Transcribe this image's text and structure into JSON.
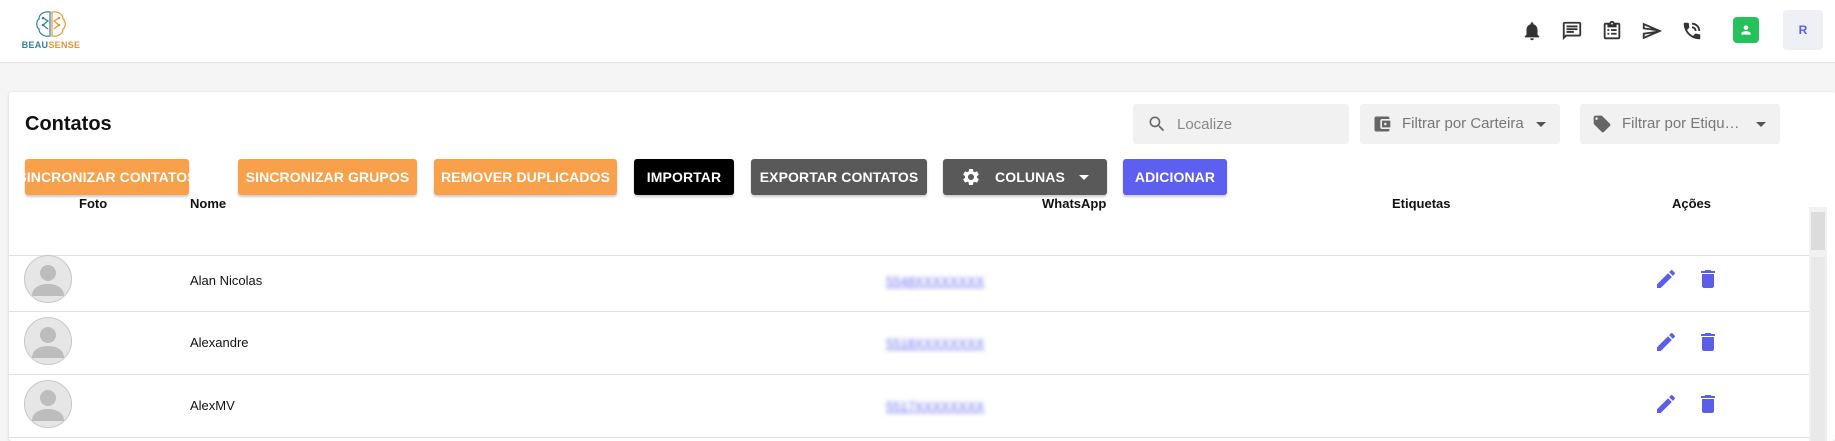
{
  "app": {
    "logo_text_1": "BEAU",
    "logo_text_2": "SENSE"
  },
  "topbar": {
    "icons": [
      "bell-icon",
      "chat-icon",
      "clipboard-icon",
      "send-icon",
      "phone-icon",
      "user-status-icon"
    ],
    "avatar_initial": "R",
    "status_color": "#25c15a",
    "accent_color": "#5b5fe8"
  },
  "page": {
    "title": "Contatos",
    "search_placeholder": "Localize",
    "filter_wallet": "Filtrar por Carteira",
    "filter_tags": "Filtrar por Etiquetas"
  },
  "toolbar": {
    "sync_contacts": "SINCRONIZAR CONTATOS",
    "sync_groups": "SINCRONIZAR GRUPOS",
    "remove_duplicates": "REMOVER DUPLICADOS",
    "import": "IMPORTAR",
    "export_contacts": "EXPORTAR CONTATOS",
    "columns": "COLUNAS",
    "add": "ADICIONAR"
  },
  "table": {
    "headers": {
      "photo": "Foto",
      "name": "Nome",
      "whatsapp": "WhatsApp",
      "tags": "Etiquetas",
      "actions": "Ações"
    },
    "rows": [
      {
        "name": "Alan Nicolas",
        "whatsapp": "5548XXXXXXXX",
        "tags": ""
      },
      {
        "name": "Alexandre",
        "whatsapp": "5518XXXXXXXX",
        "tags": ""
      },
      {
        "name": "AlexMV",
        "whatsapp": "5517XXXXXXXX",
        "tags": ""
      }
    ]
  }
}
